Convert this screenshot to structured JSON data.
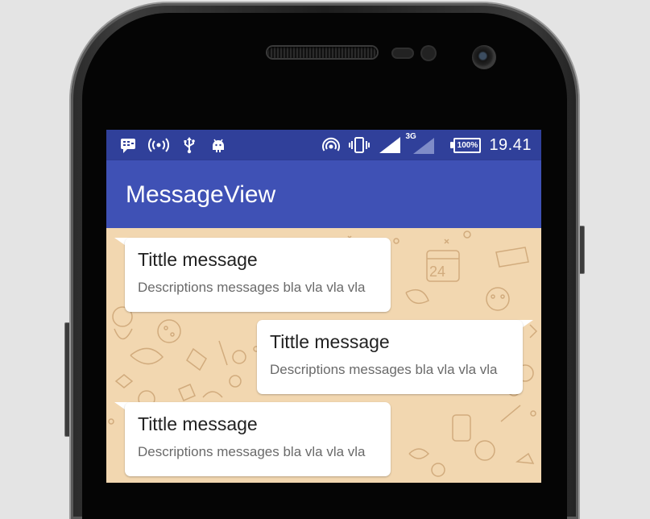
{
  "status_bar": {
    "time": "19.41",
    "network_type": "3G",
    "battery": "100%",
    "icons_left": [
      "messenger-icon",
      "hotspot-icon",
      "usb-icon",
      "android-debug-icon"
    ],
    "icons_right": [
      "nfc-icon",
      "vibrate-icon",
      "wifi-signal-icon",
      "cell-signal-icon",
      "battery-icon"
    ]
  },
  "app_bar": {
    "title": "MessageView"
  },
  "colors": {
    "status_bar": "#30409a",
    "app_bar": "#3f51b5",
    "chat_background": "#f2d7b0",
    "bubble": "#ffffff"
  },
  "messages": [
    {
      "title": "Tittle message",
      "description": "Descriptions messages bla vla vla vla",
      "side": "left"
    },
    {
      "title": "Tittle message",
      "description": "Descriptions messages bla vla vla vla",
      "side": "right"
    },
    {
      "title": "Tittle message",
      "description": "Descriptions messages bla vla vla vla",
      "side": "left"
    }
  ]
}
